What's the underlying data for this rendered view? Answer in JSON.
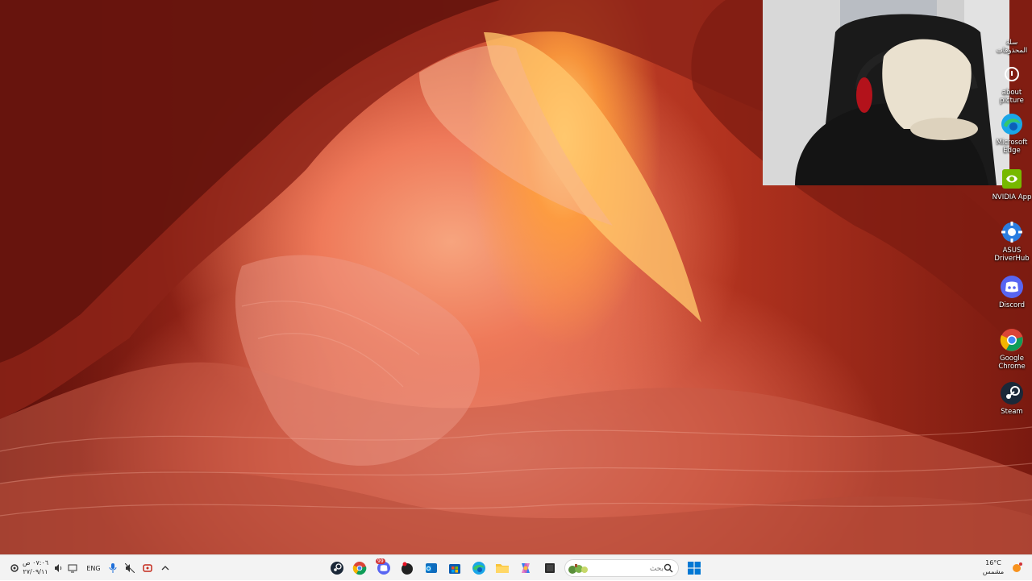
{
  "desktop": {
    "icons": [
      {
        "name": "partial-top",
        "label": "سلة المحذوفات",
        "icon": "recycle-bin-icon"
      },
      {
        "name": "about-picture",
        "label": "about picture",
        "icon": "about-picture-icon"
      },
      {
        "name": "edge",
        "label": "Microsoft Edge",
        "icon": "edge-icon"
      },
      {
        "name": "nvidia",
        "label": "NVIDIA App",
        "icon": "nvidia-icon"
      },
      {
        "name": "asus",
        "label": "ASUS DriverHub",
        "icon": "asus-icon"
      },
      {
        "name": "discord",
        "label": "Discord",
        "icon": "discord-icon"
      },
      {
        "name": "chrome",
        "label": "Google Chrome",
        "icon": "chrome-icon"
      },
      {
        "name": "steam",
        "label": "Steam",
        "icon": "steam-icon"
      }
    ],
    "wallpaper": "antelope-canyon-sandstone"
  },
  "webcam_overlay": {
    "subject": "person wearing cap and headset"
  },
  "taskbar": {
    "clock": {
      "time": "٠٧:٠٦ ص",
      "date": "٢٧/٠٩/١١"
    },
    "tray": {
      "language": "ENG",
      "icons": [
        "settings-tray-icon",
        "volume-icon",
        "network-icon",
        "language",
        "mic-icon",
        "mute-off-icon",
        "refresh-icon",
        "chevron-up-icon"
      ]
    },
    "apps": [
      {
        "name": "steam",
        "icon": "steam-icon"
      },
      {
        "name": "chrome",
        "icon": "chrome-icon"
      },
      {
        "name": "discord",
        "icon": "discord-icon",
        "badge": "99"
      },
      {
        "name": "app-dark",
        "icon": "app-icon"
      },
      {
        "name": "outlook",
        "icon": "outlook-icon"
      },
      {
        "name": "store",
        "icon": "store-icon"
      },
      {
        "name": "edge",
        "icon": "edge-icon"
      },
      {
        "name": "file-explorer",
        "icon": "folder-icon"
      },
      {
        "name": "copilot",
        "icon": "copilot-icon"
      },
      {
        "name": "terminal",
        "icon": "terminal-icon"
      }
    ],
    "search": {
      "placeholder": "بحث"
    },
    "start": {
      "icon": "windows-icon"
    },
    "weather": {
      "temp": "16°C",
      "condition": "مشمس"
    }
  },
  "colors": {
    "taskbar_bg": "#f3f3f3",
    "accent": "#0078d4",
    "canyon_light": "#ffd27a",
    "canyon_dark": "#7a1a10"
  }
}
